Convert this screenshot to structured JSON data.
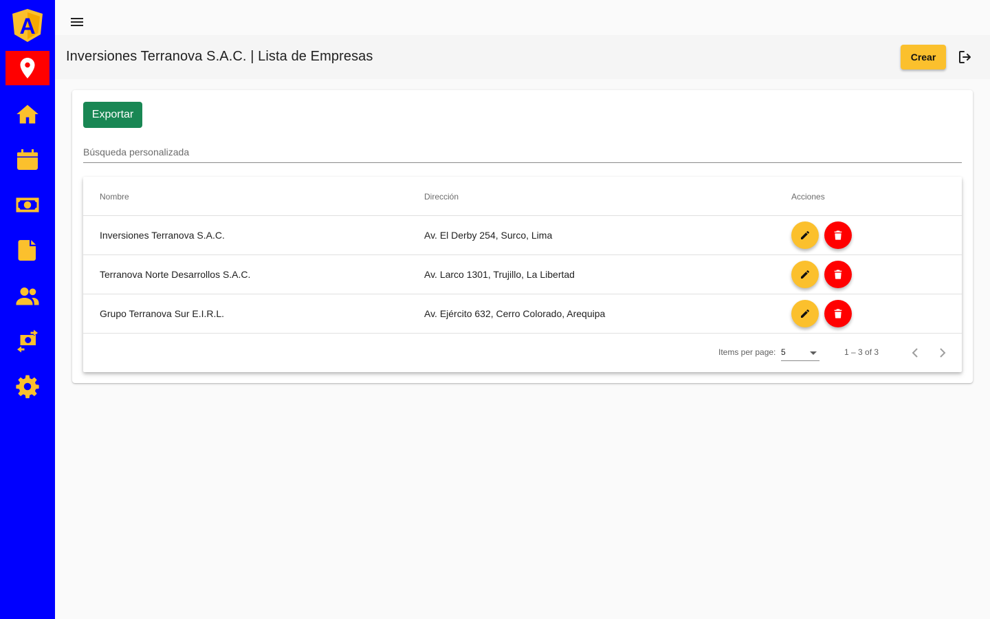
{
  "header": {
    "title": "Inversiones Terranova S.A.C. | Lista de Empresas",
    "create_label": "Crear"
  },
  "sidebar": {
    "logo_letter": "A",
    "items": [
      {
        "icon": "location-pin-icon",
        "active": true
      },
      {
        "icon": "home-icon"
      },
      {
        "icon": "calendar-icon"
      },
      {
        "icon": "money-icon"
      },
      {
        "icon": "document-icon"
      },
      {
        "icon": "users-icon"
      },
      {
        "icon": "money-exchange-icon"
      },
      {
        "icon": "gear-icon"
      }
    ]
  },
  "toolbar": {
    "export_label": "Exportar"
  },
  "search": {
    "placeholder": "Búsqueda personalizada",
    "value": ""
  },
  "table": {
    "columns": [
      "Nombre",
      "Dirección",
      "Acciones"
    ],
    "rows": [
      {
        "nombre": "Inversiones Terranova S.A.C.",
        "direccion": "Av. El Derby 254, Surco, Lima"
      },
      {
        "nombre": "Terranova Norte Desarrollos S.A.C.",
        "direccion": "Av. Larco 1301, Trujillo, La Libertad"
      },
      {
        "nombre": "Grupo Terranova Sur E.I.R.L.",
        "direccion": "Av. Ejército 632, Cerro Colorado, Arequipa"
      }
    ]
  },
  "paginator": {
    "items_per_page_label": "Items per page:",
    "items_per_page_value": "5",
    "range_label": "1 – 3 of 3"
  },
  "colors": {
    "sidebar_bg": "#0000ff",
    "icon_accent": "#fbc02d",
    "active_item_bg": "#ff0000",
    "export_button": "#198754",
    "delete_button": "#ff0000",
    "edit_button": "#fbc02d"
  }
}
